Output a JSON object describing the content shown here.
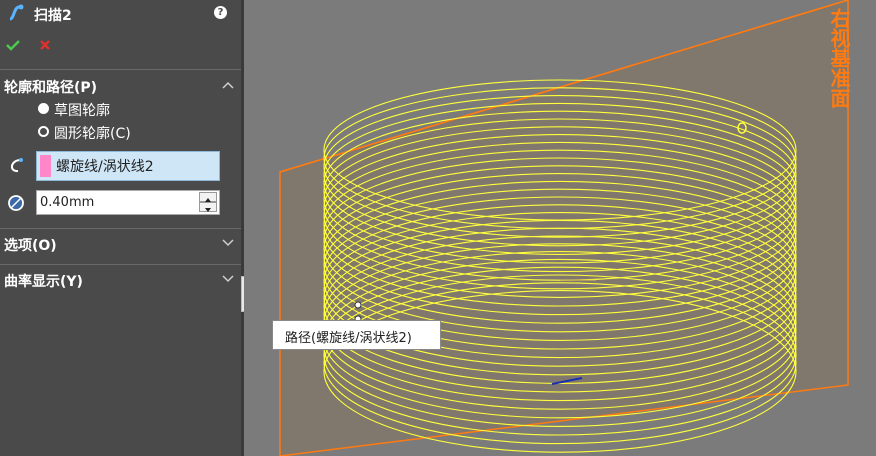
{
  "property_manager": {
    "title": "扫描2",
    "help_label": "?",
    "sections": {
      "profile_and_path": {
        "label": "轮廓和路径(P)",
        "radio_sketch": "草图轮廓",
        "radio_circle": "圆形轮廓(C)",
        "selected_profile": "circle",
        "path_selection": "螺旋线/涡状线2",
        "diameter_value": "0.40mm"
      },
      "options": {
        "label": "选项(O)"
      },
      "curvature_display": {
        "label": "曲率显示(Y)"
      }
    }
  },
  "viewport": {
    "plane_label": "右视基准面",
    "tooltip": "路径(螺旋线/涡状线2)"
  },
  "colors": {
    "panel_bg": "#4a4a4a",
    "viewport_bg": "#7b7b7b",
    "helix": "#ffff3c",
    "plane_edge": "#ff7a10",
    "selection_swatch": "#ff86c8"
  }
}
